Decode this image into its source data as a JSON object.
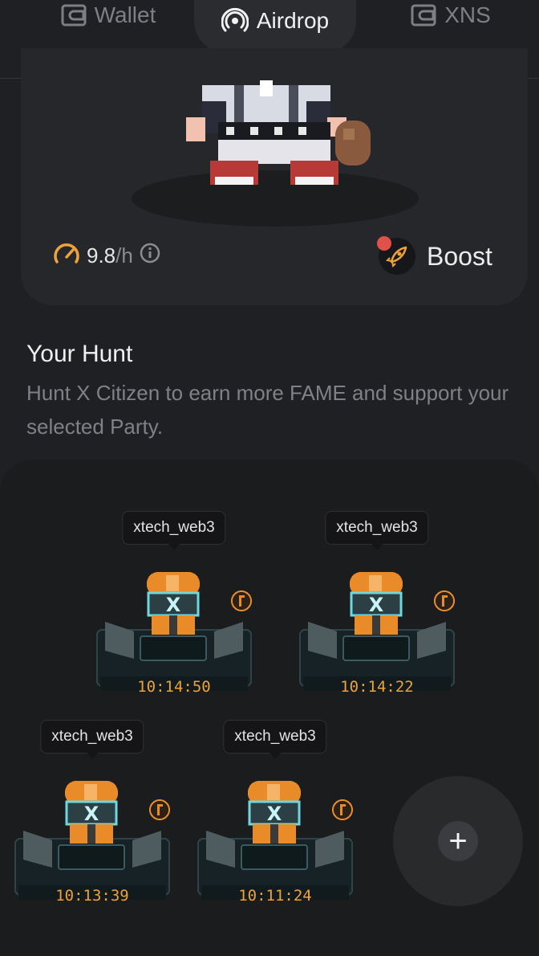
{
  "tabs": [
    {
      "label": "Wallet",
      "icon": "wallet-icon",
      "active": false
    },
    {
      "label": "Airdrop",
      "icon": "airdrop-signal-icon",
      "active": true
    },
    {
      "label": "XNS",
      "icon": "wallet-icon",
      "active": false
    }
  ],
  "stats": {
    "rate_value": "9.8",
    "rate_unit": "/h",
    "boost_label": "Boost"
  },
  "hunt": {
    "title": "Your Hunt",
    "description": "Hunt X Citizen to earn more FAME and support your selected Party."
  },
  "hunters": [
    {
      "name": "xtech_web3",
      "timer": "10:14:50"
    },
    {
      "name": "xtech_web3",
      "timer": "10:14:22"
    },
    {
      "name": "xtech_web3",
      "timer": "10:13:39"
    },
    {
      "name": "xtech_web3",
      "timer": "10:11:24"
    }
  ],
  "add_slot": {
    "label": "+"
  },
  "colors": {
    "accent": "#f0a23a",
    "notification": "#e0514c",
    "background": "#1f2023"
  }
}
